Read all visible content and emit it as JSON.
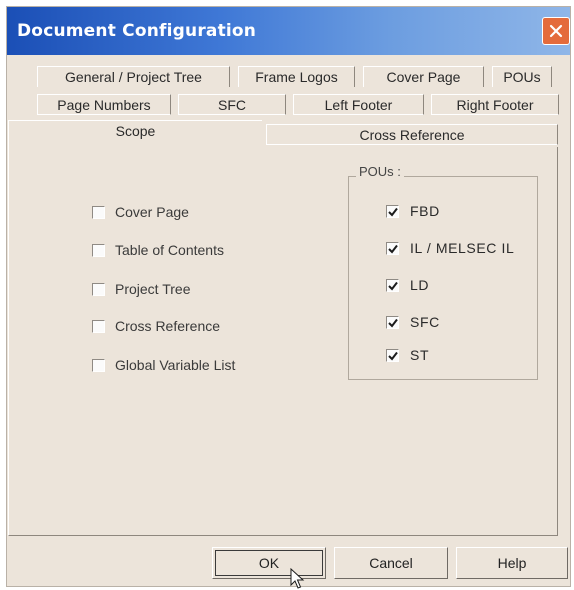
{
  "window": {
    "title": "Document Configuration",
    "close_icon": "close-icon"
  },
  "tabs": {
    "row1": [
      "General / Project Tree",
      "Frame Logos",
      "Cover Page",
      "POUs"
    ],
    "row2": [
      "Page Numbers",
      "SFC",
      "Left Footer",
      "Right Footer"
    ],
    "row3": [
      "Scope",
      "Cross Reference"
    ],
    "active": "Scope"
  },
  "scope": {
    "items": [
      {
        "label": "Cover Page",
        "checked": false
      },
      {
        "label": "Table of Contents",
        "checked": false
      },
      {
        "label": "Project Tree",
        "checked": false
      },
      {
        "label": "Cross Reference",
        "checked": false
      },
      {
        "label": "Global Variable List",
        "checked": false
      }
    ],
    "pous_group_label": "POUs :",
    "pous": [
      {
        "label": "FBD",
        "checked": true
      },
      {
        "label": "IL / MELSEC IL",
        "checked": true
      },
      {
        "label": "LD",
        "checked": true
      },
      {
        "label": "SFC",
        "checked": true
      },
      {
        "label": "ST",
        "checked": true
      }
    ]
  },
  "buttons": {
    "ok": "OK",
    "cancel": "Cancel",
    "help": "Help"
  },
  "colors": {
    "dialog_bg": "#ece4da",
    "title_gradient_start": "#1b4fb6",
    "close_button": "#e46b3c"
  }
}
